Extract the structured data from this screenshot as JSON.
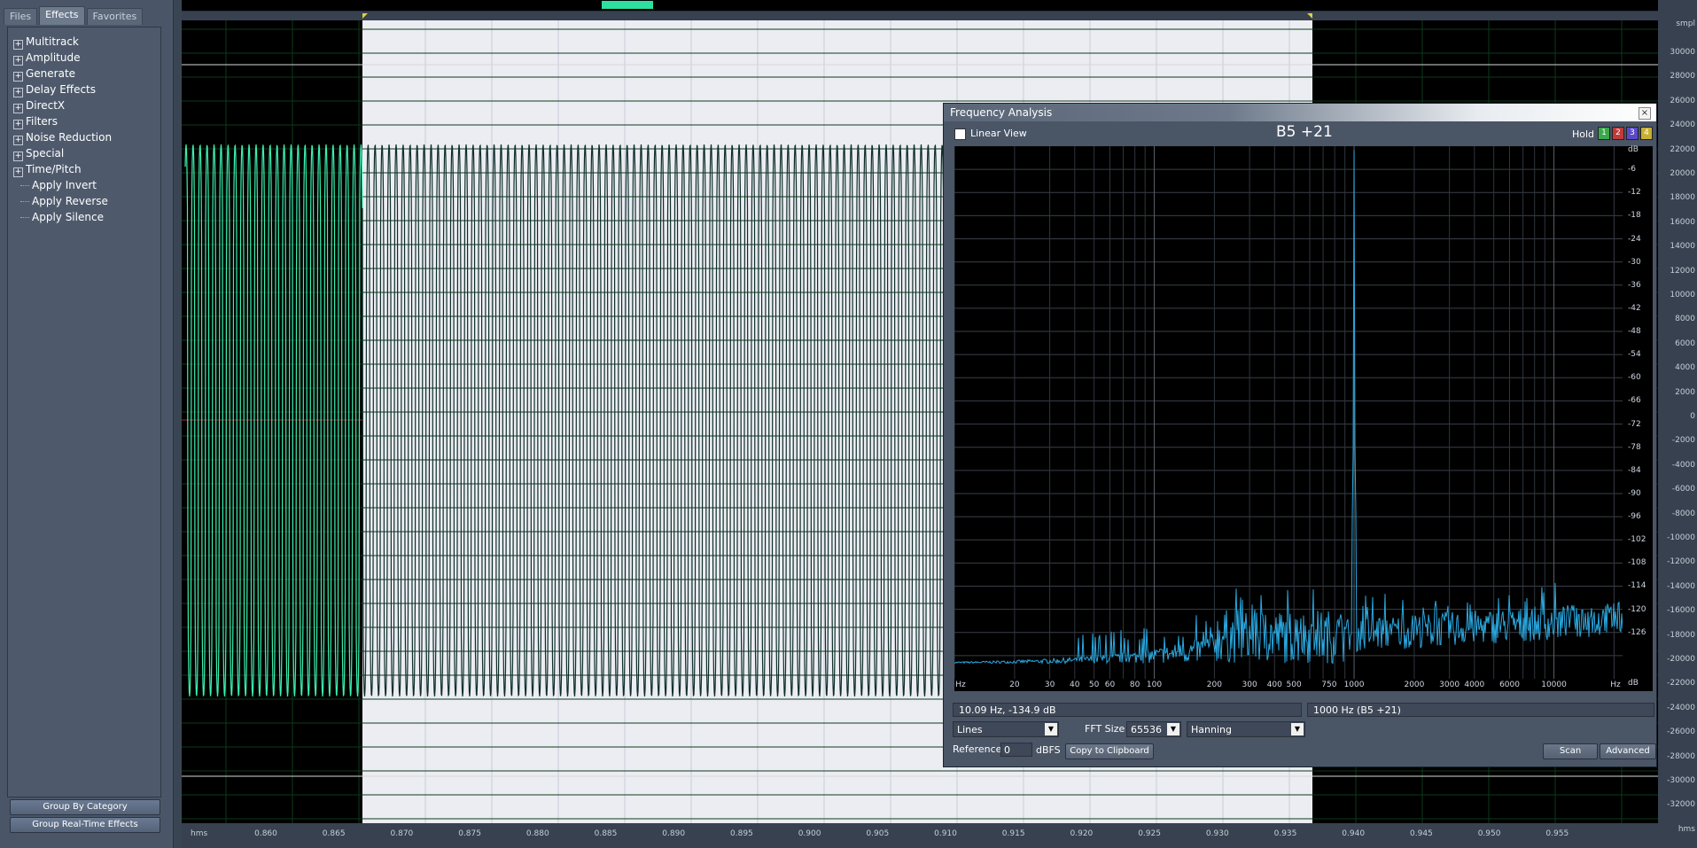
{
  "left_panel": {
    "tabs": [
      {
        "label": "Files",
        "active": false
      },
      {
        "label": "Effects",
        "active": true
      },
      {
        "label": "Favorites",
        "active": false
      }
    ],
    "tree": [
      {
        "label": "Multitrack",
        "expandable": true
      },
      {
        "label": "Amplitude",
        "expandable": true
      },
      {
        "label": "Generate",
        "expandable": true
      },
      {
        "label": "Delay Effects",
        "expandable": true
      },
      {
        "label": "DirectX",
        "expandable": true
      },
      {
        "label": "Filters",
        "expandable": true
      },
      {
        "label": "Noise Reduction",
        "expandable": true
      },
      {
        "label": "Special",
        "expandable": true
      },
      {
        "label": "Time/Pitch",
        "expandable": true
      },
      {
        "label": "Apply Invert",
        "expandable": false
      },
      {
        "label": "Apply Reverse",
        "expandable": false
      },
      {
        "label": "Apply Silence",
        "expandable": false
      }
    ],
    "group_by_category": "Group By Category",
    "group_realtime": "Group Real-Time Effects"
  },
  "waveform": {
    "time_unit": "hms",
    "time_ticks": [
      "0.860",
      "0.865",
      "0.870",
      "0.875",
      "0.880",
      "0.885",
      "0.890",
      "0.895",
      "0.900",
      "0.905",
      "0.910",
      "0.915",
      "0.920",
      "0.925",
      "0.930",
      "0.935",
      "0.940",
      "0.945",
      "0.950",
      "0.955"
    ],
    "amp_unit": "smpl",
    "amp_ticks": [
      "30000",
      "28000",
      "26000",
      "24000",
      "22000",
      "20000",
      "18000",
      "16000",
      "14000",
      "12000",
      "10000",
      "8000",
      "6000",
      "4000",
      "2000",
      "0",
      "-2000",
      "-4000",
      "-6000",
      "-8000",
      "-10000",
      "-12000",
      "-14000",
      "-16000",
      "-18000",
      "-20000",
      "-22000",
      "-24000",
      "-26000",
      "-28000",
      "-30000",
      "-32000"
    ],
    "amp_right_unit": "hms",
    "colors": {
      "unselected_wave": "#3cf0b0",
      "selected_wave": "#0e2e2a",
      "selection_bg": "#ecedf3"
    }
  },
  "freq_window": {
    "title": "Frequency Analysis",
    "close": "×",
    "linear_view_label": "Linear View",
    "linear_view_checked": false,
    "note": "B5 +21",
    "hold_label": "Hold",
    "hold_buttons": [
      {
        "label": "1",
        "color": "#3aa84a"
      },
      {
        "label": "2",
        "color": "#c03a3a"
      },
      {
        "label": "3",
        "color": "#5a4ac8"
      },
      {
        "label": "4",
        "color": "#c8b030"
      }
    ],
    "freq_axis_unit": "Hz",
    "freq_ticks": [
      "20",
      "30",
      "40",
      "50",
      "60",
      "80",
      "100",
      "200",
      "300",
      "400",
      "500",
      "750",
      "1000",
      "2000",
      "3000",
      "4000",
      "6000",
      "10000"
    ],
    "db_unit": "dB",
    "db_ticks": [
      "-6",
      "-12",
      "-18",
      "-24",
      "-30",
      "-36",
      "-42",
      "-48",
      "-54",
      "-60",
      "-66",
      "-72",
      "-78",
      "-84",
      "-90",
      "-96",
      "-102",
      "-108",
      "-114",
      "-120",
      "-126"
    ],
    "cursor_readout": "10.09 Hz, -134.9 dB",
    "peak_readout": "1000 Hz (B5 +21)",
    "plot_type": "Lines",
    "fft_size_label": "FFT Size",
    "fft_size": "65536",
    "window_fn": "Hanning",
    "reference_label": "Reference",
    "reference_value": "0",
    "reference_unit": "dBFS",
    "copy_button": "Copy to Clipboard",
    "scan_button": "Scan",
    "advanced_button": "Advanced",
    "spectrum_color": "#2aa8e0"
  }
}
